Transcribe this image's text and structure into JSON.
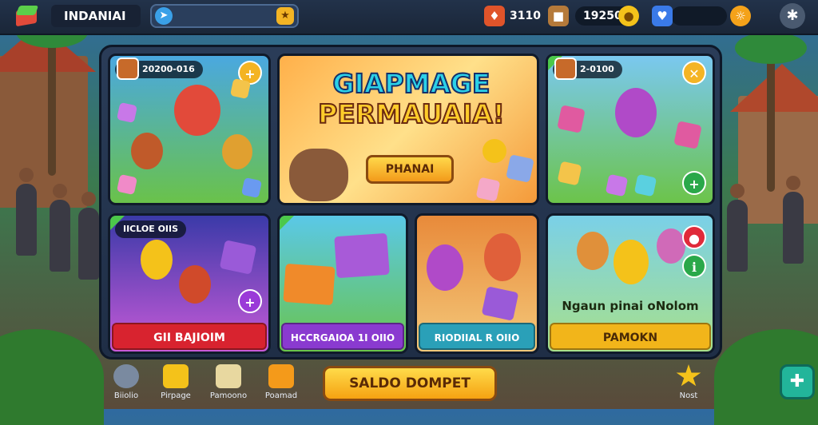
{
  "topbar": {
    "brand": "INDANIAI",
    "stat1": "3110",
    "stat2": "19250",
    "search_icon": "compass-icon",
    "coin_icon": "coin-icon"
  },
  "cards": {
    "top_left": {
      "badge": "20200-016"
    },
    "hero": {
      "line1": "GIAPMAGE",
      "line2": "PERMAUAIA!",
      "button": "PHANAI"
    },
    "top_right": {
      "badge": "2-0100"
    },
    "mid_left": {
      "badge": "IICLOE OIIS",
      "button": "GII BAJIOIM"
    },
    "mid_2": {
      "button": "HCCRGAIOA 1I OIIO"
    },
    "mid_3": {
      "button": "RIODIIAL R OIIO"
    },
    "mid_right": {
      "text": "Ngaun pinai oNolom",
      "button": "PAMOKN"
    }
  },
  "bottom_nav": [
    {
      "label": "Biiolio",
      "icon": "gear-icon"
    },
    {
      "label": "Pirpage",
      "icon": "chest-icon"
    },
    {
      "label": "Pamoono",
      "icon": "box-icon"
    },
    {
      "label": "Poamad",
      "icon": "puzzle-icon"
    }
  ],
  "wallet_button": "SALDO DOMPET",
  "star_label": "Nost",
  "colors": {
    "accent_gold": "#f5a212",
    "red_button": "#d8232f",
    "purple_button": "#8a3ad0",
    "teal_button": "#2aa0b8",
    "gold_button": "#f2b51a"
  }
}
